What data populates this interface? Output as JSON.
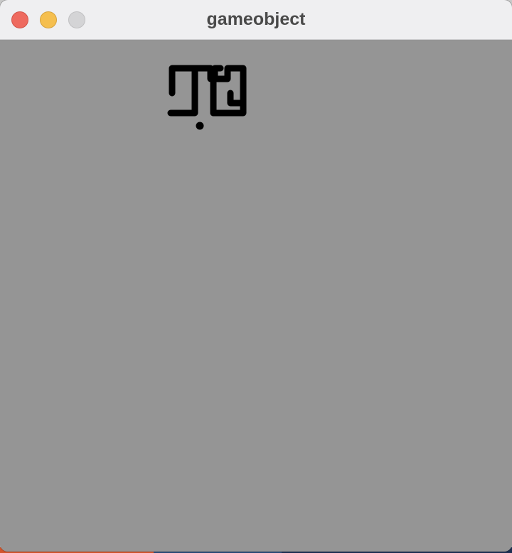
{
  "window": {
    "title": "gameobject"
  },
  "colors": {
    "titlebar": "#efeff1",
    "canvas_background": "#959595",
    "sprite": "#000000",
    "close_button": "#ee6a5f",
    "minimize_button": "#f5bf4f",
    "zoom_button": "#d4d4d6"
  },
  "game": {
    "objects": [
      {
        "kind": "maze-sprite",
        "color": "#000000"
      },
      {
        "kind": "ball",
        "color": "#000000"
      }
    ]
  }
}
